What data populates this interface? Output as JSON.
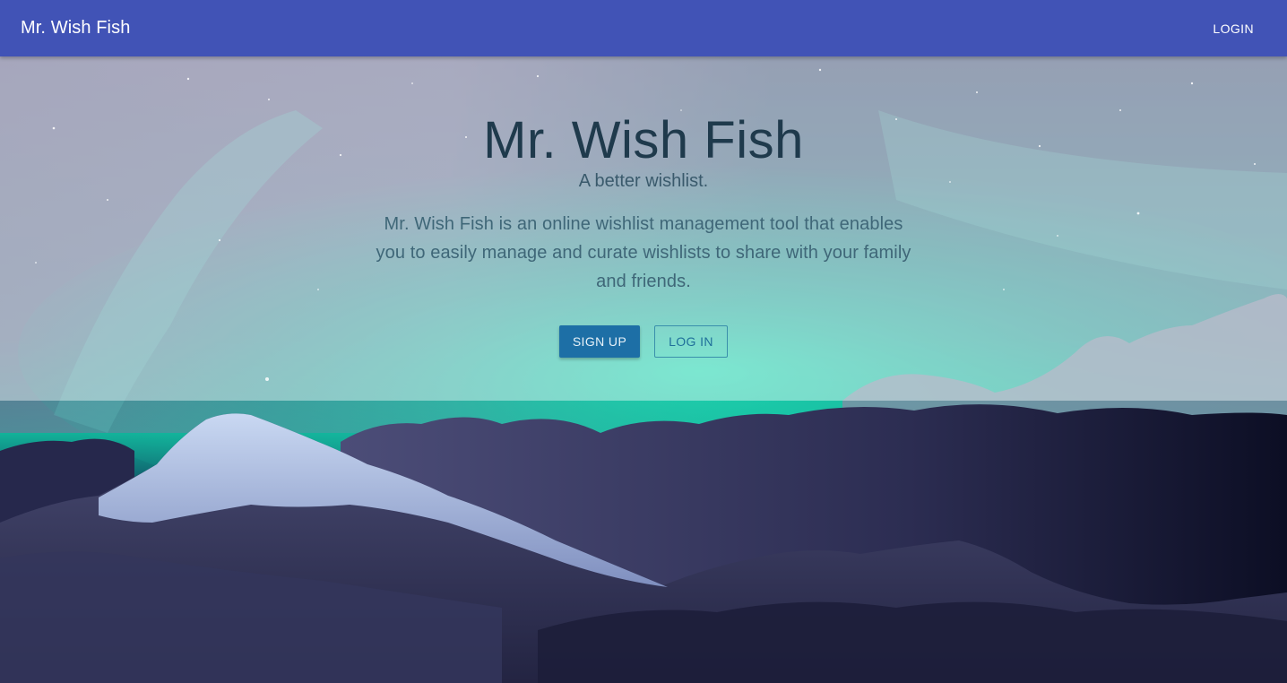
{
  "app_bar": {
    "title": "Mr. Wish Fish",
    "login_label": "LOGIN",
    "color": "#4153b6"
  },
  "hero": {
    "title": "Mr. Wish Fish",
    "subtitle": "A better wishlist.",
    "description": "Mr. Wish Fish is an online wishlist management tool that enables you to easily manage and curate wishlists to share with your family and friends.",
    "signup_label": "SIGN UP",
    "login_label": "LOG IN",
    "signup_color": "#1d6fa6"
  },
  "background": {
    "image": "aurora-mountain-night-sky"
  }
}
